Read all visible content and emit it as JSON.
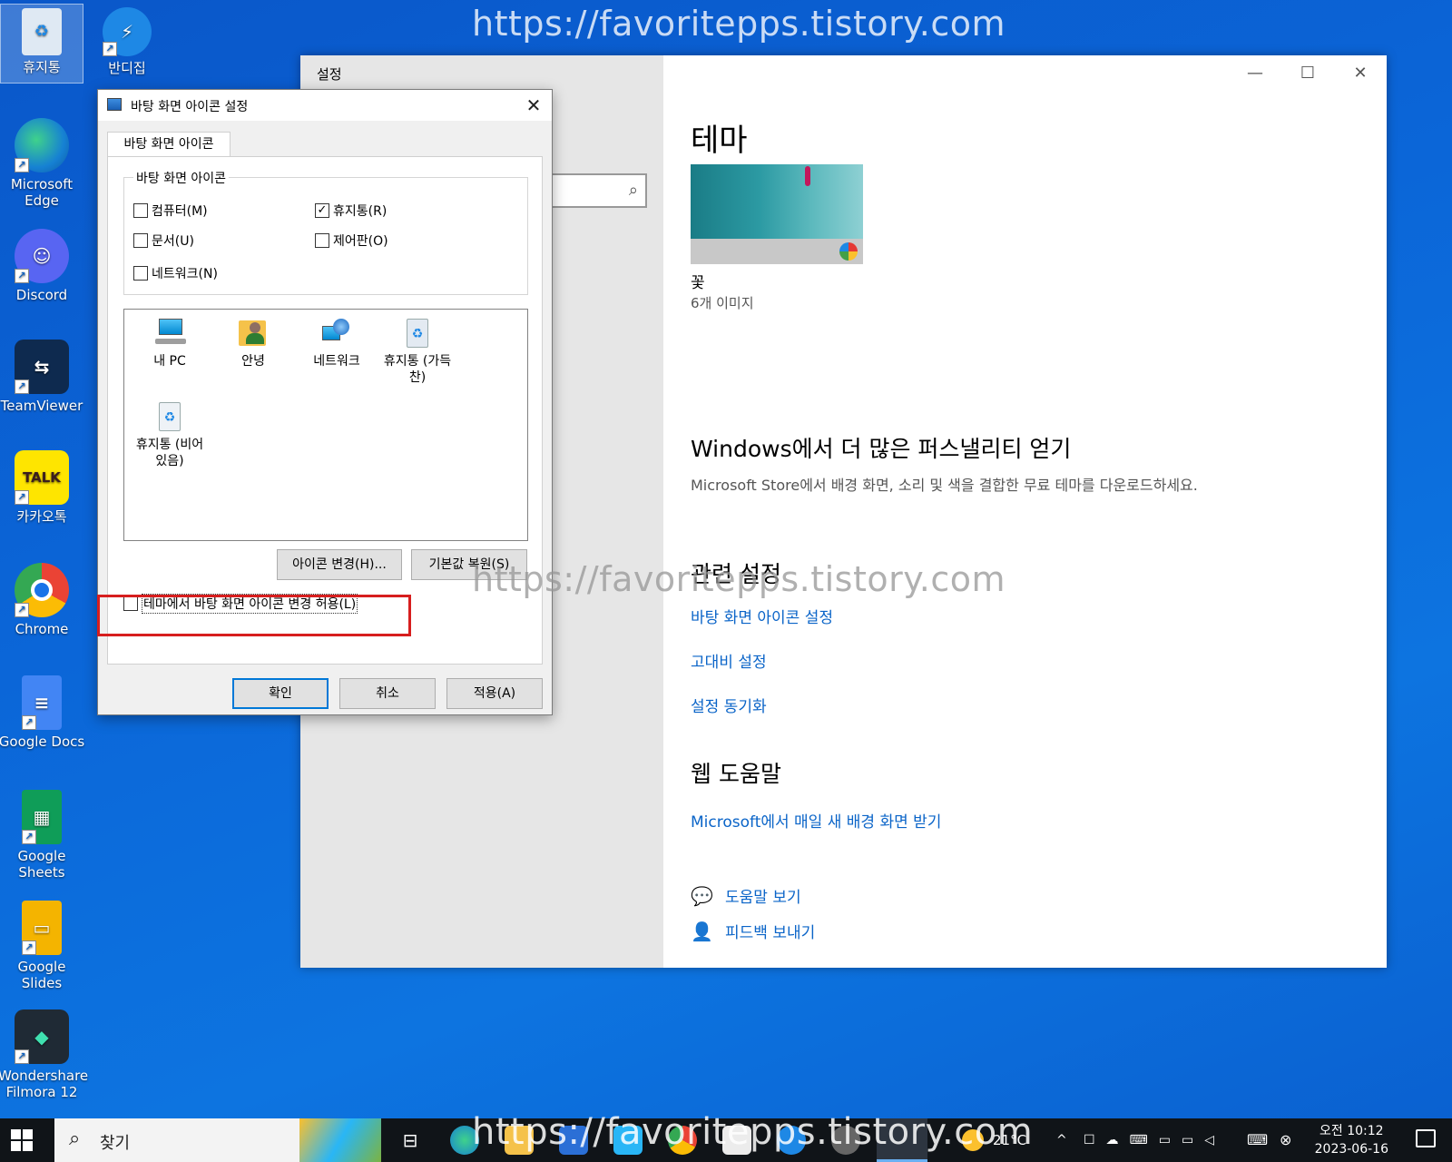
{
  "watermark": "https://favoritepps.tistory.com",
  "desktop": {
    "icons": [
      {
        "label": "휴지통",
        "icon": "recycle-bin-icon"
      },
      {
        "label": "반디집",
        "icon": "bandizip-icon"
      },
      {
        "label": "Microsoft Edge",
        "icon": "edge-icon"
      },
      {
        "label": "Discord",
        "icon": "discord-icon"
      },
      {
        "label": "TeamViewer",
        "icon": "teamviewer-icon"
      },
      {
        "label": "카카오톡",
        "icon": "kakaotalk-icon",
        "badge": "TALK"
      },
      {
        "label": "Chrome",
        "icon": "chrome-icon"
      },
      {
        "label": "Google Docs",
        "icon": "google-docs-icon"
      },
      {
        "label": "Google Sheets",
        "icon": "google-sheets-icon"
      },
      {
        "label": "Google Slides",
        "icon": "google-slides-icon"
      },
      {
        "label": "Wondershare Filmora 12",
        "icon": "filmora-icon"
      }
    ]
  },
  "settings": {
    "window_title": "설정",
    "theme_heading": "테마",
    "theme_name": "꽃",
    "theme_count": "6개 이미지",
    "more_heading": "Windows에서 더 많은 퍼스낼리티 얻기",
    "more_desc": "Microsoft Store에서 배경 화면, 소리 및 색을 결합한 무료 테마를 다운로드하세요.",
    "related_heading": "관련 설정",
    "related_links": [
      "바탕 화면 아이콘 설정",
      "고대비 설정",
      "설정 동기화"
    ],
    "web_heading": "웹 도움말",
    "web_link": "Microsoft에서 매일 새 배경 화면 받기",
    "help_link": "도움말 보기",
    "feedback_link": "피드백 보내기"
  },
  "dialog": {
    "title": "바탕 화면 아이콘 설정",
    "tab": "바탕 화면 아이콘",
    "group_label": "바탕 화면 아이콘",
    "checkboxes": [
      {
        "label": "컴퓨터(M)",
        "checked": false
      },
      {
        "label": "휴지통(R)",
        "checked": true
      },
      {
        "label": "문서(U)",
        "checked": false
      },
      {
        "label": "제어판(O)",
        "checked": false
      },
      {
        "label": "네트워크(N)",
        "checked": false
      }
    ],
    "icon_items": [
      "내 PC",
      "안녕",
      "네트워크",
      "휴지통 (가득 찬)",
      "휴지통 (비어 있음)"
    ],
    "change_icon_button": "아이콘 변경(H)...",
    "restore_button": "기본값 복원(S)",
    "allow_theme_label": "테마에서 바탕 화면 아이콘 변경 허용(L)",
    "allow_theme_checked": false,
    "ok_button": "확인",
    "cancel_button": "취소",
    "apply_button": "적용(A)"
  },
  "taskbar": {
    "search_placeholder": "찾기",
    "temperature": "21°C",
    "time": "오전 10:12",
    "date": "2023-06-16"
  }
}
